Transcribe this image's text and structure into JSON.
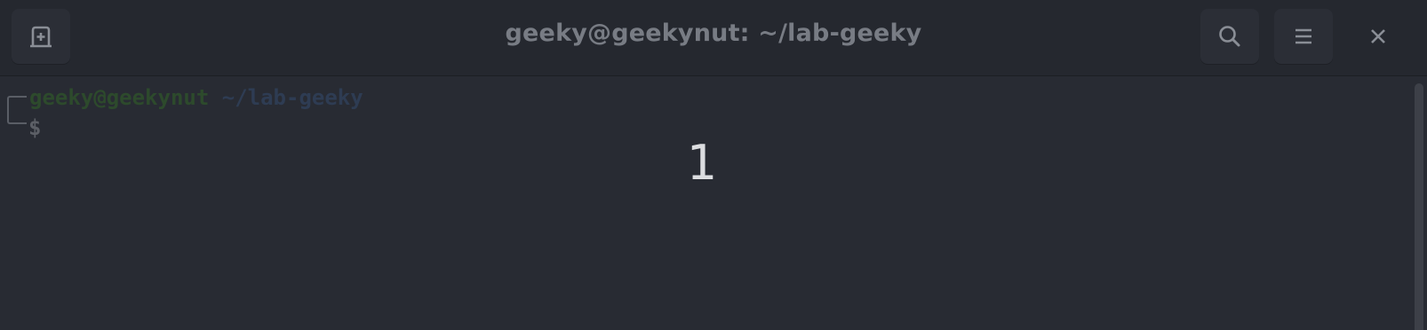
{
  "window": {
    "title": "geeky@geekynut: ~/lab-geeky"
  },
  "toolbar": {
    "new_tab_icon": "new-tab-icon",
    "search_icon": "search-icon",
    "menu_icon": "hamburger-menu-icon",
    "close_icon": "close-icon"
  },
  "terminal": {
    "user_host": "geeky@geekynut",
    "cwd": "~/lab-geeky",
    "prompt_symbol": "$"
  },
  "overlay": {
    "number": "1"
  },
  "colors": {
    "background": "#282b33",
    "headerbar": "#25282f",
    "user_host": "#2d4a2c",
    "cwd": "#2e3c53",
    "title": "#787c84"
  }
}
